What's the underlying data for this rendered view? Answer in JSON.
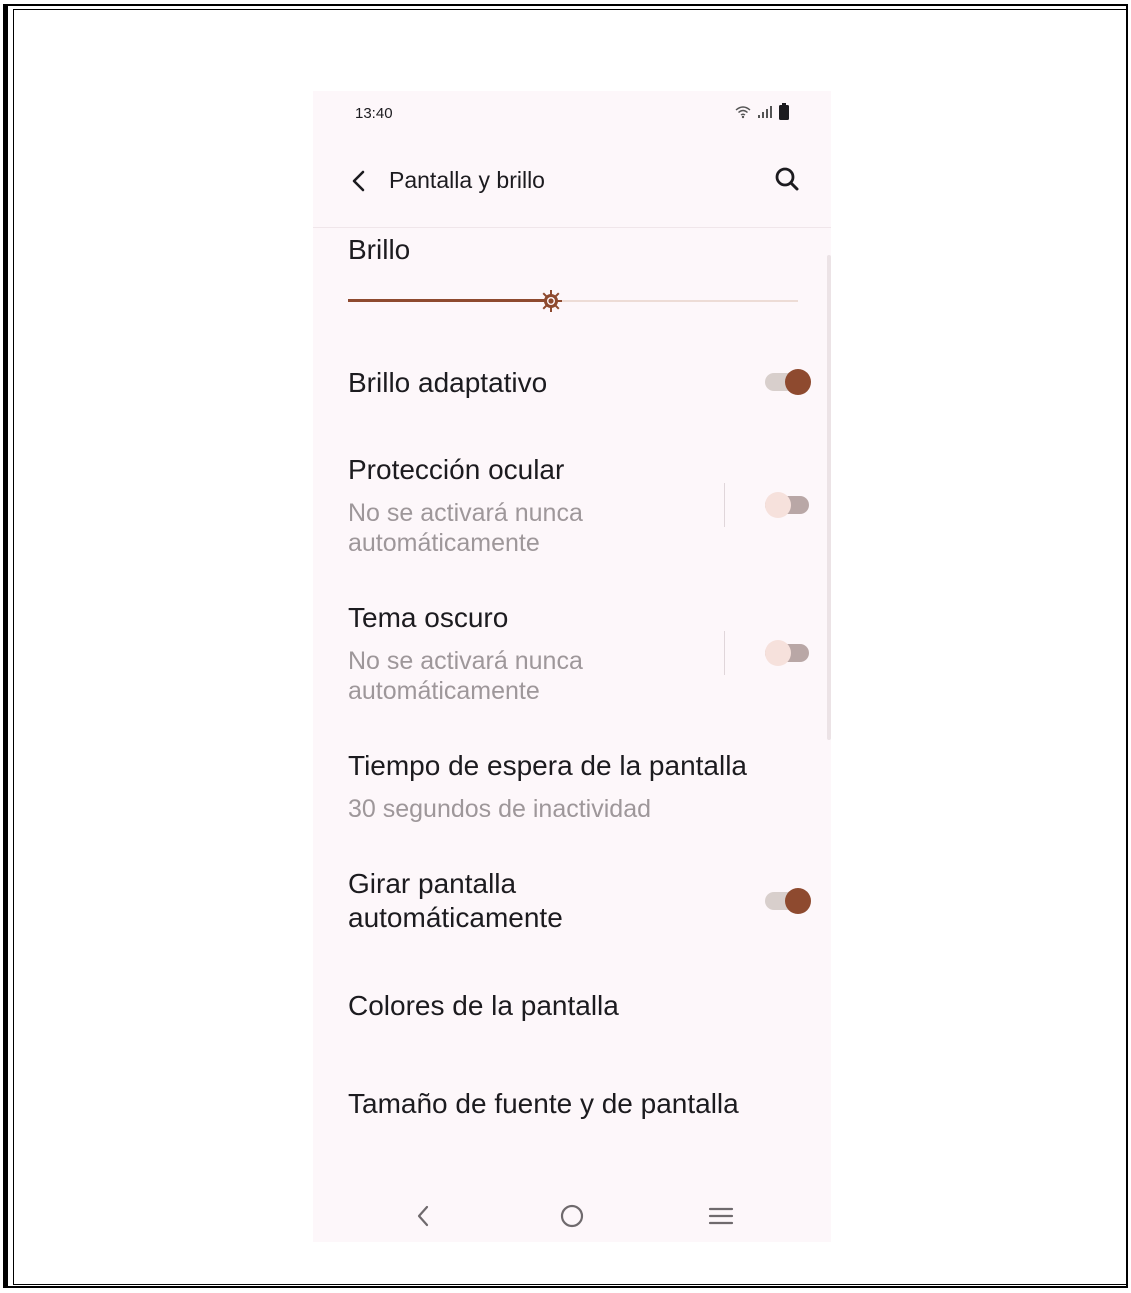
{
  "status_bar": {
    "time": "13:40"
  },
  "app_bar": {
    "title": "Pantalla y brillo"
  },
  "brightness": {
    "label": "Brillo",
    "level": 0.45
  },
  "settings": {
    "adaptive_brightness": {
      "title": "Brillo adaptativo",
      "enabled": true
    },
    "eye_protection": {
      "title": "Protección ocular",
      "subtitle_line1": "No se activará nunca",
      "subtitle_line2": "automáticamente",
      "enabled": false
    },
    "dark_theme": {
      "title": "Tema oscuro",
      "subtitle_line1": "No se activará nunca",
      "subtitle_line2": "automáticamente",
      "enabled": false
    },
    "screen_timeout": {
      "title": "Tiempo de espera de la pantalla",
      "subtitle": "30 segundos de inactividad"
    },
    "auto_rotate": {
      "title_line1": "Girar pantalla",
      "title_line2": "automáticamente",
      "enabled": true
    },
    "screen_colors": {
      "title": "Colores de la pantalla"
    },
    "font_display_size": {
      "title": "Tamaño de fuente y de pantalla"
    }
  },
  "colors": {
    "accent": "#8e4a2f",
    "background": "#fdf7fa",
    "secondary_text": "#9e979a"
  }
}
